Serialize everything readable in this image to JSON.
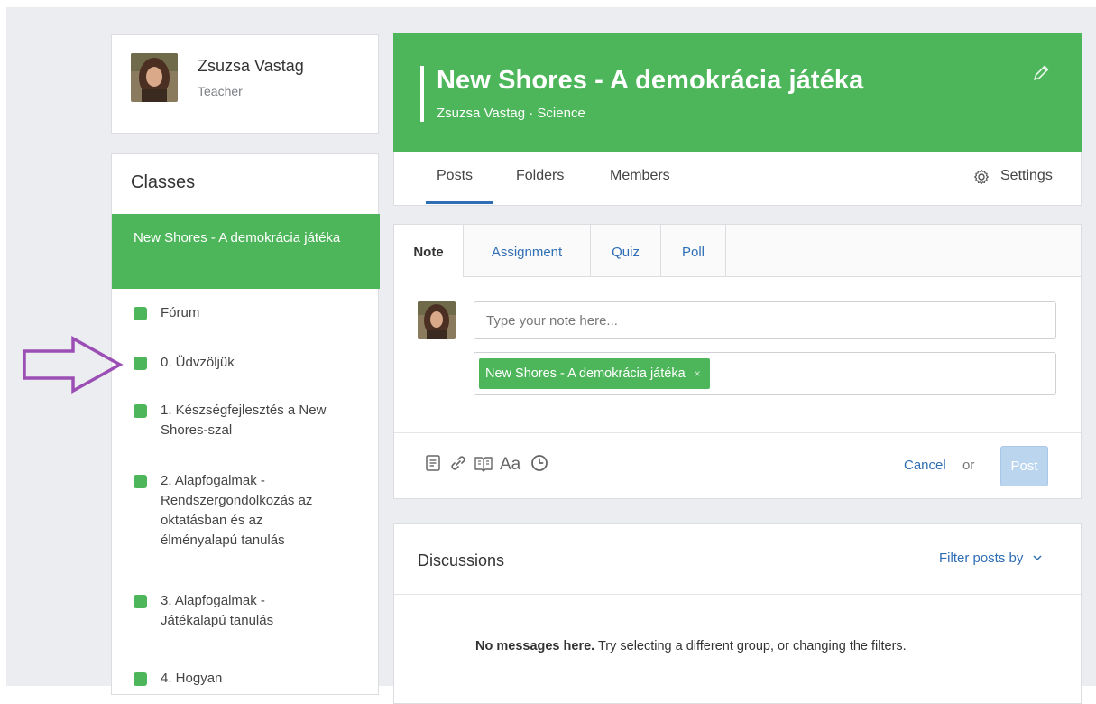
{
  "user": {
    "name": "Zsuzsa Vastag",
    "role": "Teacher"
  },
  "sidebar": {
    "title": "Classes",
    "active_class": "New Shores - A demokrácia játéka",
    "groups": [
      "Fórum",
      "0. Üdvzöljük",
      "1. Készségfejlesztés a New Shores-szal",
      "2. Alapfogalmak - Rendszergondolkozás az oktatásban és az élményalapú tanulás",
      "3. Alapfogalmak - Játékalapú tanulás",
      "4. Hogyan"
    ]
  },
  "header": {
    "title": "New Shores - A demokrácia játéka",
    "subtitle": "Zsuzsa Vastag · Science"
  },
  "nav": {
    "tabs": [
      "Posts",
      "Folders",
      "Members"
    ],
    "active": "Posts",
    "settings": "Settings"
  },
  "composer": {
    "tabs": [
      "Note",
      "Assignment",
      "Quiz",
      "Poll"
    ],
    "active_tab": "Note",
    "placeholder": "Type your note here...",
    "recipient": "New Shores - A demokrácia játéka",
    "cancel": "Cancel",
    "or": "or",
    "post": "Post",
    "tool_icons": [
      "file-icon",
      "link-icon",
      "library-icon",
      "font-size-icon",
      "clock-icon"
    ]
  },
  "discussions": {
    "title": "Discussions",
    "filter": "Filter posts by",
    "empty_bold": "No messages here.",
    "empty_rest": " Try selecting a different group, or changing the filters."
  },
  "colors": {
    "brand_green": "#4eb65a",
    "link_blue": "#2f6eb5",
    "arrow_purple": "#9b4fb4",
    "background": "#ecedf0"
  }
}
